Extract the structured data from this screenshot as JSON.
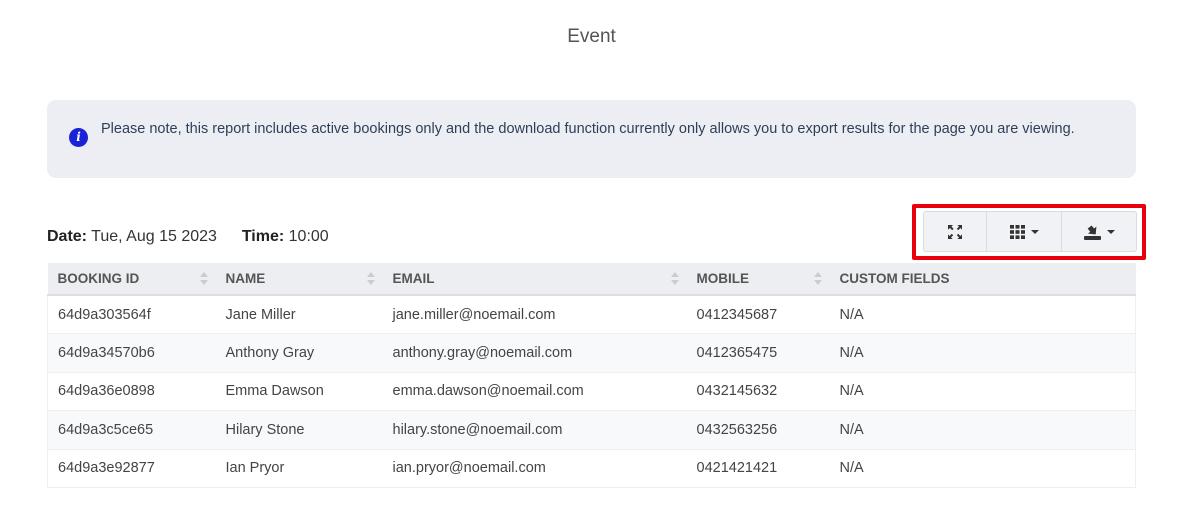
{
  "page": {
    "title": "Event"
  },
  "notice": {
    "icon": "info-icon",
    "icon_glyph": "i",
    "text": "Please note, this report includes active bookings only and the download function currently only allows you to export results for the page you are viewing.",
    "color": "#1a22d8"
  },
  "meta": {
    "date_label": "Date:",
    "date_value": "Tue, Aug 15 2023",
    "time_label": "Time:",
    "time_value": "10:00"
  },
  "toolbar": {
    "buttons": [
      {
        "icon": "fullscreen-icon",
        "has_dropdown": false
      },
      {
        "icon": "columns-grid-icon",
        "has_dropdown": true
      },
      {
        "icon": "export-download-icon",
        "has_dropdown": true
      }
    ],
    "highlight_color": "#e8000b"
  },
  "table": {
    "columns": [
      {
        "label": "BOOKING ID",
        "sortable": true
      },
      {
        "label": "NAME",
        "sortable": true
      },
      {
        "label": "EMAIL",
        "sortable": true
      },
      {
        "label": "MOBILE",
        "sortable": true
      },
      {
        "label": "CUSTOM FIELDS",
        "sortable": false
      }
    ],
    "rows": [
      [
        "64d9a303564f",
        "Jane Miller",
        "jane.miller@noemail.com",
        "0412345687",
        "N/A"
      ],
      [
        "64d9a34570b6",
        "Anthony Gray",
        "anthony.gray@noemail.com",
        "0412365475",
        "N/A"
      ],
      [
        "64d9a36e0898",
        "Emma Dawson",
        "emma.dawson@noemail.com",
        "0432145632",
        "N/A"
      ],
      [
        "64d9a3c5ce65",
        "Hilary Stone",
        "hilary.stone@noemail.com",
        "0432563256",
        "N/A"
      ],
      [
        "64d9a3e92877",
        "Ian Pryor",
        "ian.pryor@noemail.com",
        "0421421421",
        "N/A"
      ]
    ]
  }
}
